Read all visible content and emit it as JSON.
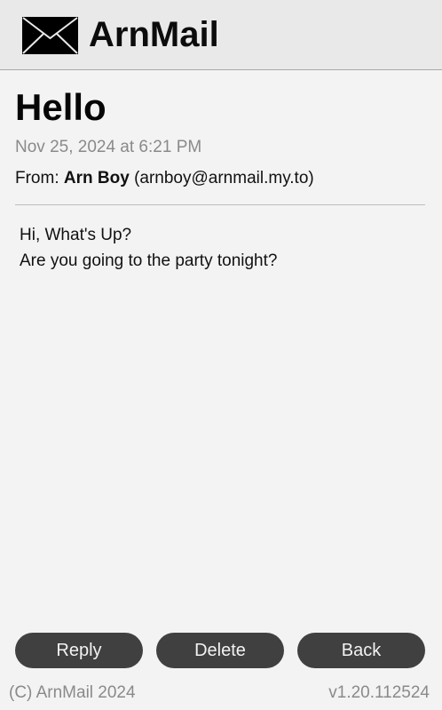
{
  "header": {
    "logo_icon": "envelope-icon",
    "title": "ArnMail"
  },
  "message": {
    "subject": "Hello",
    "date": "Nov 25, 2024 at 6:21 PM",
    "from_label": "From:",
    "sender_name": "Arn Boy",
    "sender_email": "(arnboy@arnmail.my.to)",
    "body_lines": [
      "Hi, What's Up?",
      "Are you going to the party tonight?"
    ]
  },
  "actions": {
    "reply_label": "Reply",
    "delete_label": "Delete",
    "back_label": "Back"
  },
  "footer": {
    "copyright": "(C) ArnMail 2024",
    "version": "v1.20.112524"
  },
  "colors": {
    "header_bg": "#e9e9e9",
    "page_bg": "#f3f3f3",
    "button_bg": "#404040",
    "muted_text": "#8a8a8a"
  }
}
